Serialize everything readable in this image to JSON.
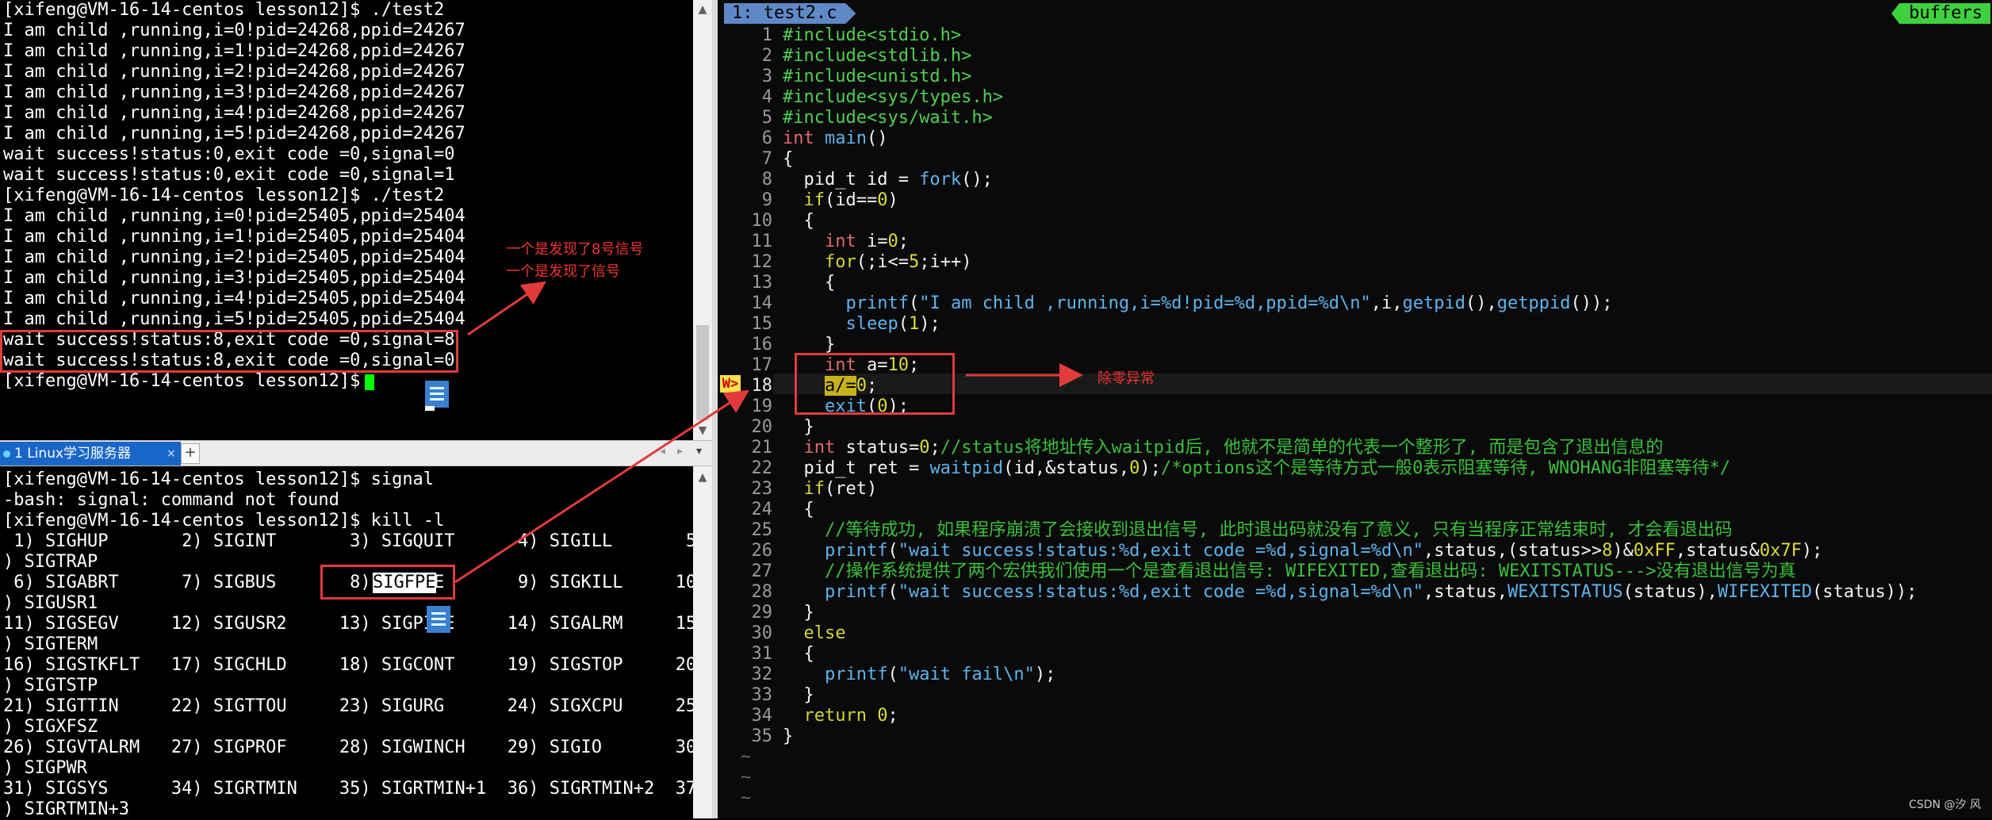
{
  "terminal_top": {
    "lines": [
      "[xifeng@VM-16-14-centos lesson12]$ ./test2",
      "I am child ,running,i=0!pid=24268,ppid=24267",
      "I am child ,running,i=1!pid=24268,ppid=24267",
      "I am child ,running,i=2!pid=24268,ppid=24267",
      "I am child ,running,i=3!pid=24268,ppid=24267",
      "I am child ,running,i=4!pid=24268,ppid=24267",
      "I am child ,running,i=5!pid=24268,ppid=24267",
      "wait success!status:0,exit code =0,signal=0",
      "wait success!status:0,exit code =0,signal=1",
      "[xifeng@VM-16-14-centos lesson12]$ ./test2",
      "I am child ,running,i=0!pid=25405,ppid=25404",
      "I am child ,running,i=1!pid=25405,ppid=25404",
      "I am child ,running,i=2!pid=25405,ppid=25404",
      "I am child ,running,i=3!pid=25405,ppid=25404",
      "I am child ,running,i=4!pid=25405,ppid=25404",
      "I am child ,running,i=5!pid=25405,ppid=25404",
      "wait success!status:8,exit code =0,signal=8",
      "wait success!status:8,exit code =0,signal=0",
      "[xifeng@VM-16-14-centos lesson12]$ "
    ]
  },
  "session_tab": {
    "label": "1 Linux学习服务器",
    "close": "×",
    "add": "+",
    "prev": "◂",
    "next": "▸",
    "menu": "▾"
  },
  "terminal_bottom": {
    "lines": [
      "[xifeng@VM-16-14-centos lesson12]$ signal",
      "-bash: signal: command not found",
      "[xifeng@VM-16-14-centos lesson12]$ kill -l",
      " 1) SIGHUP       2) SIGINT       3) SIGQUIT      4) SIGILL       5",
      ") SIGTRAP",
      " 6) SIGABRT      7) SIGBUS       8) SIGFPE       9) SIGKILL     10",
      ") SIGUSR1",
      "11) SIGSEGV     12) SIGUSR2     13) SIGPIPE     14) SIGALRM     15",
      ") SIGTERM",
      "16) SIGSTKFLT   17) SIGCHLD     18) SIGCONT     19) SIGSTOP     20",
      ") SIGTSTP",
      "21) SIGTTIN     22) SIGTTOU     23) SIGURG      24) SIGXCPU     25",
      ") SIGXFSZ",
      "26) SIGVTALRM   27) SIGPROF     28) SIGWINCH    29) SIGIO       30",
      ") SIGPWR",
      "31) SIGSYS      34) SIGRTMIN    35) SIGRTMIN+1  36) SIGRTMIN+2  37",
      ") SIGRTMIN+3"
    ]
  },
  "editor": {
    "tab_label": "1: test2.c",
    "buffers_label": "buffers",
    "sign_label": "W>",
    "line_numbers": [
      "1",
      "2",
      "3",
      "4",
      "5",
      "6",
      "7",
      "8",
      "9",
      "10",
      "11",
      "12",
      "13",
      "14",
      "15",
      "16",
      "17",
      "18",
      "19",
      "20",
      "21",
      "22",
      "23",
      "24",
      "25",
      "26",
      "27",
      "28",
      "29",
      "30",
      "31",
      "32",
      "33",
      "34",
      "35"
    ],
    "tildes": [
      "~",
      "~",
      "~"
    ],
    "code": {
      "l1": "#include<stdio.h>",
      "l2": "#include<stdlib.h>",
      "l3": "#include<unistd.h>",
      "l4": "#include<sys/types.h>",
      "l5": "#include<sys/wait.h>",
      "l6_type": "int",
      "l6_fn": "main",
      "l6_rest": "()",
      "l7": "{",
      "l8_a": "  pid_t id = ",
      "l8_fn": "fork",
      "l8_b": "();",
      "l9_kw": "if",
      "l9_a": "(id==",
      "l9_num": "0",
      "l9_b": ")",
      "l10": "  {",
      "l11_type": "int",
      "l11_a": " i=",
      "l11_num": "0",
      "l11_b": ";",
      "l12_kw": "for",
      "l12_a": "(;i<=",
      "l12_num": "5",
      "l12_b": ";i++)",
      "l13": "    {",
      "l14_fn": "printf",
      "l14_a": "(",
      "l14_str": "\"I am child ,running,i=%d!pid=%d,ppid=%d\\n\"",
      "l14_b": ",i,",
      "l14_fn2": "getpid",
      "l14_c": "(),",
      "l14_fn3": "getppid",
      "l14_d": "());",
      "l15_fn": "sleep",
      "l15_a": "(",
      "l15_num": "1",
      "l15_b": ");",
      "l16": "    }",
      "l17_type": "int",
      "l17_a": " a=",
      "l17_num": "10",
      "l17_b": ";",
      "l18_sel": "a",
      "l18_mid": "/=",
      "l18_num": "0",
      "l18_b": ";",
      "l19_fn": "exit",
      "l19_a": "(",
      "l19_num": "0",
      "l19_b": ");",
      "l20": "  }",
      "l21_type": "int",
      "l21_a": " status=",
      "l21_num": "0",
      "l21_b": ";",
      "l21_com": "//status将地址传入waitpid后, 他就不是简单的代表一个整形了, 而是包含了退出信息的",
      "l22_a": "  pid_t ret = ",
      "l22_fn": "waitpid",
      "l22_b": "(id,&status,",
      "l22_num": "0",
      "l22_c": ");",
      "l22_com": "/*options这个是等待方式一般0表示阻塞等待, WNOHANG非阻塞等待*/",
      "l23_kw": "if",
      "l23_a": "(ret)",
      "l24": "  {",
      "l25_com": "//等待成功, 如果程序崩溃了会接收到退出信号, 此时退出码就没有了意义, 只有当程序正常结束时, 才会看退出码",
      "l26_fn": "printf",
      "l26_a": "(",
      "l26_str": "\"wait success!status:%d,exit code =%d,signal=%d\\n\"",
      "l26_b": ",status,(status>>",
      "l26_num": "8",
      "l26_c": ")&",
      "l26_num2": "0xFF",
      "l26_d": ",status&",
      "l26_num3": "0x7F",
      "l26_e": ");",
      "l27_com": "//操作系统提供了两个宏供我们使用一个是查看退出信号: WIFEXITED,查看退出码: WEXITSTATUS--->没有退出信号为真",
      "l28_fn": "printf",
      "l28_a": "(",
      "l28_str": "\"wait success!status:%d,exit code =%d,signal=%d\\n\"",
      "l28_b": ",status,",
      "l28_fn2": "WEXITSTATUS",
      "l28_c": "(status),",
      "l28_fn3": "WIFEXITED",
      "l28_d": "(status));",
      "l29": "  }",
      "l30_kw": "else",
      "l31": "  {",
      "l32_fn": "printf",
      "l32_a": "(",
      "l32_str": "\"wait fail\\n\"",
      "l32_b": ");",
      "l33": "  }",
      "l34_kw": "return",
      "l34_num": "0",
      "l34_b": ";",
      "l35": "}"
    }
  },
  "annotations": {
    "signal8_line1": "一个是发现了8号信号",
    "signal8_line2": "一个是发现了信号",
    "div_zero": "除零异常"
  },
  "watermark": "CSDN @汐  风",
  "colors": {
    "annotation_red": "#e13b3b",
    "vim_tab_blue": "#5f88c6",
    "buffers_green": "#3ed13e",
    "cursor_green": "#00ff00",
    "session_tab_blue": "#1a66c8"
  },
  "icons": [
    "file-icon",
    "file-icon"
  ]
}
